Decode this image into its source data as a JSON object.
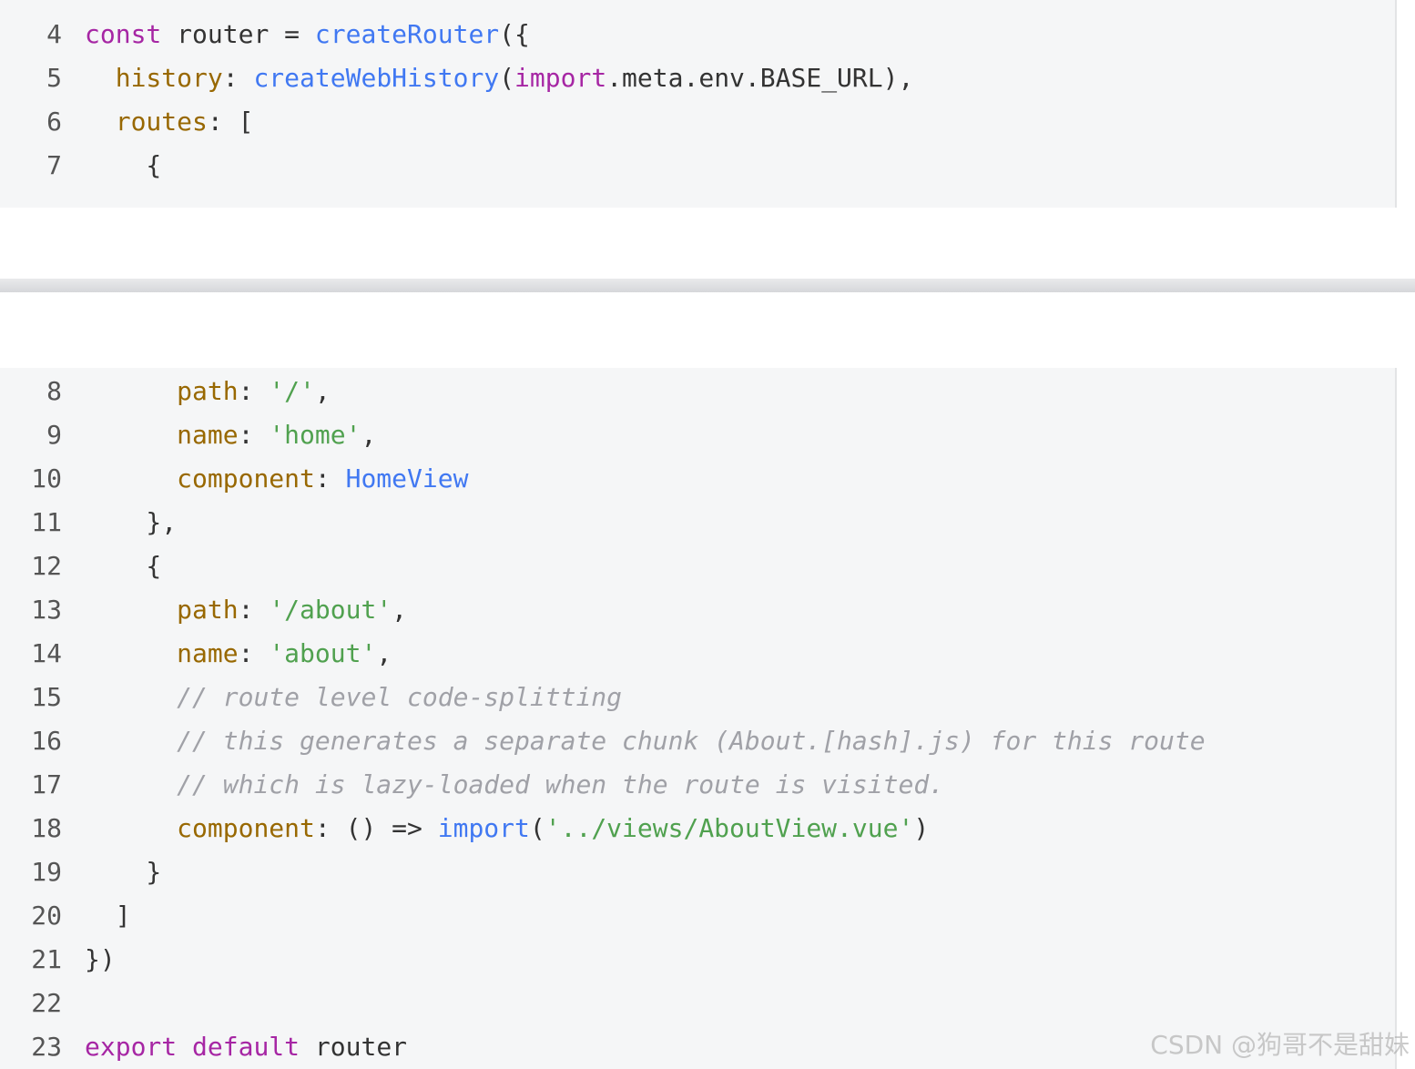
{
  "colors": {
    "keyword": "#a626a4",
    "function": "#4078f2",
    "property": "#986801",
    "string": "#50a14f",
    "comment": "#a0a1a7",
    "plain": "#333333",
    "background": "#f5f6f7"
  },
  "top_block": {
    "lines": [
      {
        "n": "4",
        "tokens": [
          [
            "kw",
            "const"
          ],
          [
            "pl",
            " router = "
          ],
          [
            "fn",
            "createRouter"
          ],
          [
            "pl",
            "({"
          ]
        ]
      },
      {
        "n": "5",
        "tokens": [
          [
            "pl",
            "  "
          ],
          [
            "prop",
            "history"
          ],
          [
            "pl",
            ": "
          ],
          [
            "fn",
            "createWebHistory"
          ],
          [
            "pl",
            "("
          ],
          [
            "kw",
            "import"
          ],
          [
            "pl",
            ".meta.env.BASE_URL),"
          ]
        ]
      },
      {
        "n": "6",
        "tokens": [
          [
            "pl",
            "  "
          ],
          [
            "prop",
            "routes"
          ],
          [
            "pl",
            ": ["
          ]
        ]
      },
      {
        "n": "7",
        "tokens": [
          [
            "pl",
            "    {"
          ]
        ]
      }
    ]
  },
  "bottom_block": {
    "lines": [
      {
        "n": "8",
        "tokens": [
          [
            "pl",
            "      "
          ],
          [
            "prop",
            "path"
          ],
          [
            "pl",
            ": "
          ],
          [
            "str",
            "'/'"
          ],
          [
            "pl",
            ","
          ]
        ]
      },
      {
        "n": "9",
        "tokens": [
          [
            "pl",
            "      "
          ],
          [
            "prop",
            "name"
          ],
          [
            "pl",
            ": "
          ],
          [
            "str",
            "'home'"
          ],
          [
            "pl",
            ","
          ]
        ]
      },
      {
        "n": "10",
        "tokens": [
          [
            "pl",
            "      "
          ],
          [
            "prop",
            "component"
          ],
          [
            "pl",
            ": "
          ],
          [
            "fn",
            "HomeView"
          ]
        ]
      },
      {
        "n": "11",
        "tokens": [
          [
            "pl",
            "    },"
          ]
        ]
      },
      {
        "n": "12",
        "tokens": [
          [
            "pl",
            "    {"
          ]
        ]
      },
      {
        "n": "13",
        "tokens": [
          [
            "pl",
            "      "
          ],
          [
            "prop",
            "path"
          ],
          [
            "pl",
            ": "
          ],
          [
            "str",
            "'/about'"
          ],
          [
            "pl",
            ","
          ]
        ]
      },
      {
        "n": "14",
        "tokens": [
          [
            "pl",
            "      "
          ],
          [
            "prop",
            "name"
          ],
          [
            "pl",
            ": "
          ],
          [
            "str",
            "'about'"
          ],
          [
            "pl",
            ","
          ]
        ]
      },
      {
        "n": "15",
        "tokens": [
          [
            "pl",
            "      "
          ],
          [
            "cm",
            "// route level code-splitting"
          ]
        ]
      },
      {
        "n": "16",
        "tokens": [
          [
            "pl",
            "      "
          ],
          [
            "cm",
            "// this generates a separate chunk (About.[hash].js) for this route"
          ]
        ]
      },
      {
        "n": "17",
        "tokens": [
          [
            "pl",
            "      "
          ],
          [
            "cm",
            "// which is lazy-loaded when the route is visited."
          ]
        ]
      },
      {
        "n": "18",
        "tokens": [
          [
            "pl",
            "      "
          ],
          [
            "prop",
            "component"
          ],
          [
            "pl",
            ": () => "
          ],
          [
            "fn",
            "import"
          ],
          [
            "pl",
            "("
          ],
          [
            "str",
            "'../views/AboutView.vue'"
          ],
          [
            "pl",
            ")"
          ]
        ]
      },
      {
        "n": "19",
        "tokens": [
          [
            "pl",
            "    }"
          ]
        ]
      },
      {
        "n": "20",
        "tokens": [
          [
            "pl",
            "  ]"
          ]
        ]
      },
      {
        "n": "21",
        "tokens": [
          [
            "pl",
            "})"
          ]
        ]
      },
      {
        "n": "22",
        "tokens": []
      },
      {
        "n": "23",
        "tokens": [
          [
            "kw",
            "export"
          ],
          [
            "pl",
            " "
          ],
          [
            "kw",
            "default"
          ],
          [
            "pl",
            " router"
          ]
        ]
      }
    ]
  },
  "watermark": "CSDN @狗哥不是甜妹"
}
